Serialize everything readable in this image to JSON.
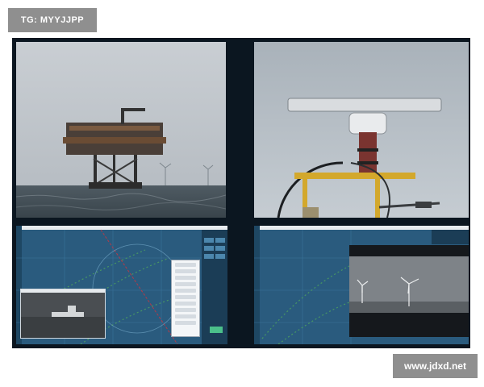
{
  "watermarks": {
    "top_left": "TG: MYYJJPP",
    "bottom_right": "www.jdxd.net"
  },
  "colors": {
    "wall_background": "#0b1620",
    "sea_chart": "#2a5b7e",
    "chart_grid": "#3f7aa2",
    "watermark_bg": "#8f8f8f"
  },
  "tiles": [
    {
      "id": "offshore-platform-photo"
    },
    {
      "id": "radar-antenna-photo"
    },
    {
      "id": "sea-chart-with-thermal-camera"
    },
    {
      "id": "sea-chart-with-wind-turbine-camera"
    }
  ]
}
